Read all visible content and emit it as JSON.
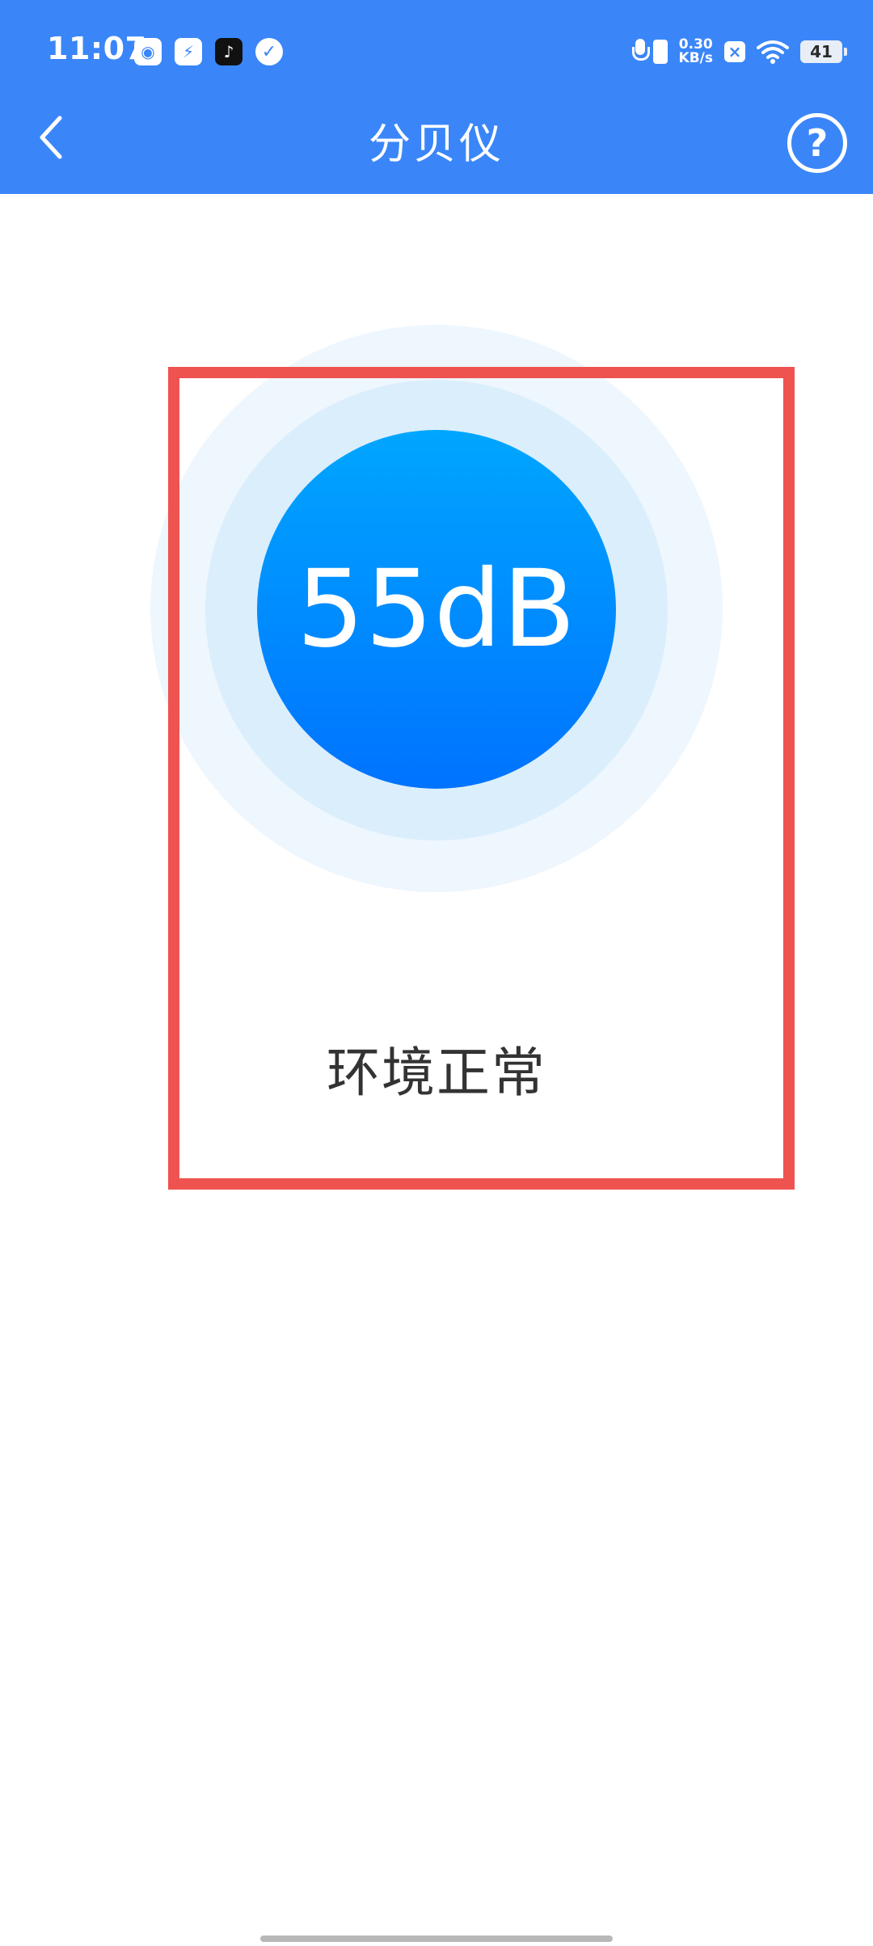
{
  "status_bar": {
    "time": "11:07",
    "net_speed_value": "0.30",
    "net_speed_unit": "KB/s",
    "battery": "41"
  },
  "app_bar": {
    "title": "分贝仪"
  },
  "meter": {
    "value": "55dB",
    "status": "环境正常"
  },
  "colors": {
    "header": "#3a86f9",
    "meter_gradient_top": "#00a6ff",
    "meter_gradient_bottom": "#0073ff",
    "highlight": "#ef5350"
  },
  "icons": {
    "back": "chevron-left-icon",
    "help": "question-circle-icon"
  }
}
